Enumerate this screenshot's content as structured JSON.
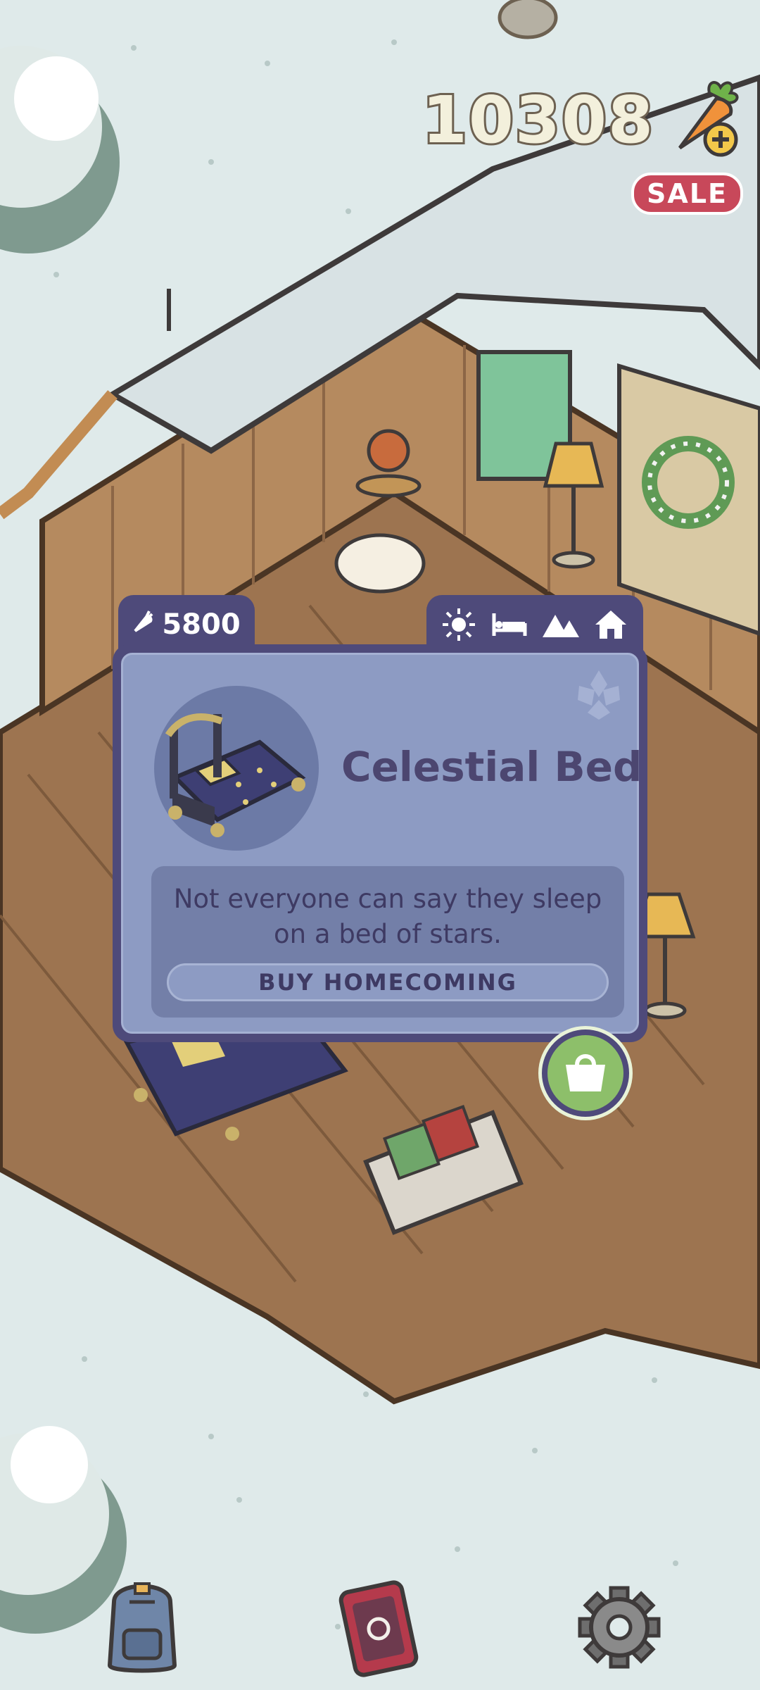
{
  "hud": {
    "carrots": "10308",
    "sale_label": "SALE",
    "carrot_icon": "carrot-plus-icon"
  },
  "item_popup": {
    "price": "5800",
    "price_icon": "carrot-icon",
    "category_tabs": [
      {
        "name": "sun-icon"
      },
      {
        "name": "bed-icon"
      },
      {
        "name": "mountains-icon"
      },
      {
        "name": "home-icon"
      }
    ],
    "title": "Celestial Bed",
    "description": "Not everyone can say they sleep on a bed of stars.",
    "buy_label": "BUY HOMECOMING",
    "shop_icon": "shopping-bag-icon"
  },
  "bottom_bar": [
    {
      "name": "backpack-icon"
    },
    {
      "name": "phone-icon"
    },
    {
      "name": "gear-icon"
    }
  ],
  "colors": {
    "snow": "#dfeaea",
    "popup_frame": "#4e4a7a",
    "popup_fill": "#8d9bc3",
    "sale": "#c8485a",
    "shop_button": "#8dbf6a"
  }
}
